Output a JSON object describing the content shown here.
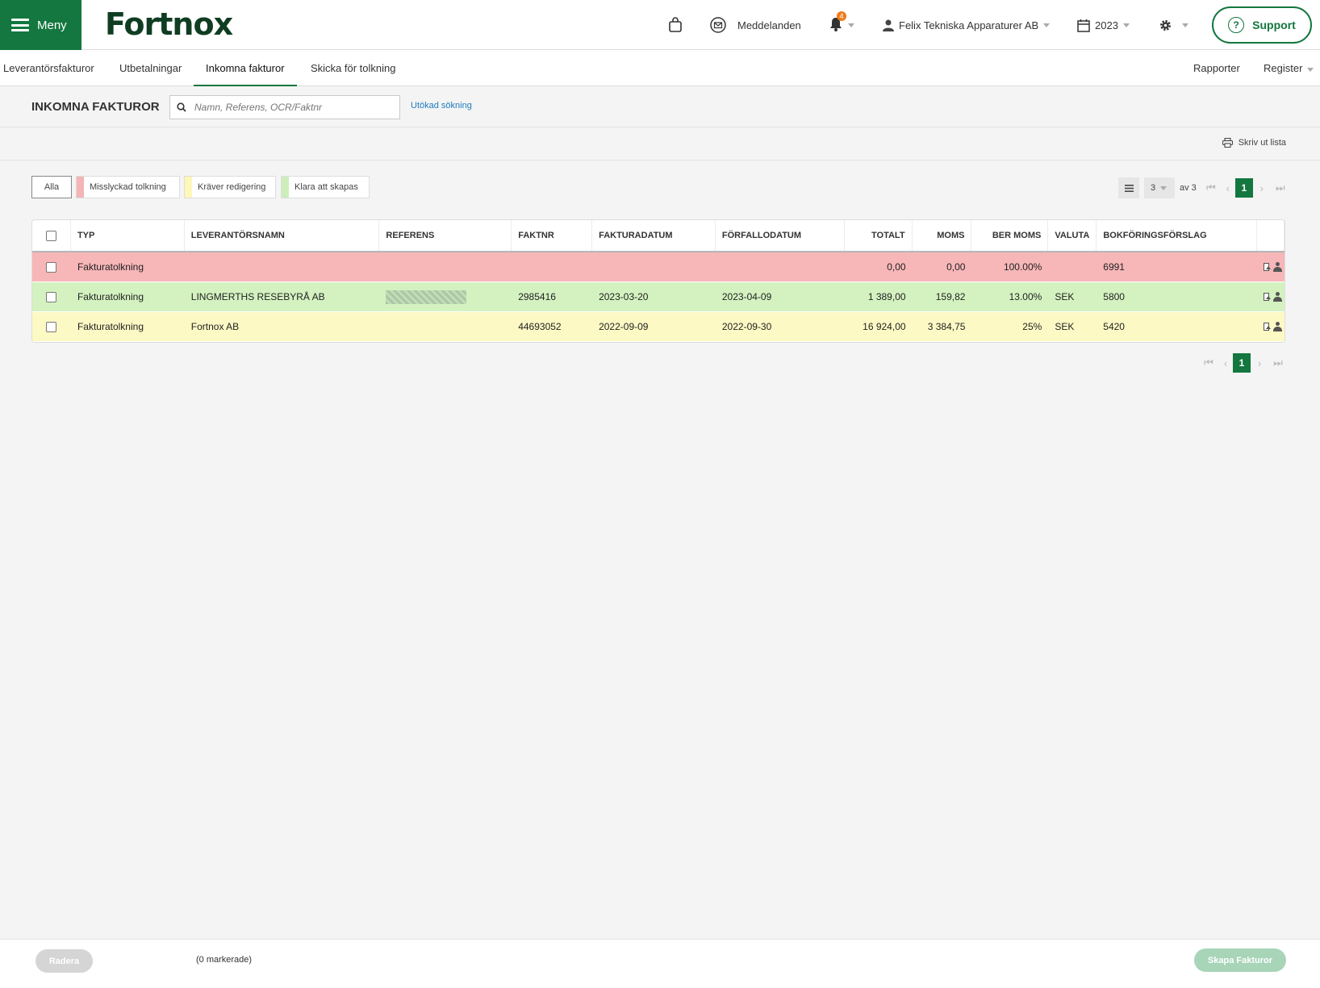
{
  "topbar": {
    "menu_label": "Meny",
    "logo_text": "Fortnox",
    "messages_label": "Meddelanden",
    "notifications_count": "4",
    "company_label": "Felix Tekniska Apparaturer AB",
    "year_label": "2023",
    "support_label": "Support"
  },
  "subnav": {
    "tabs": [
      {
        "label": "Leverantörsfakturor"
      },
      {
        "label": "Utbetalningar"
      },
      {
        "label": "Inkomna fakturor",
        "active": true
      },
      {
        "label": "Skicka för tolkning"
      }
    ],
    "right": [
      {
        "label": "Rapporter"
      },
      {
        "label": "Register"
      }
    ]
  },
  "header": {
    "title": "INKOMNA FAKTUROR",
    "search_placeholder": "Namn, Referens, OCR/Faktnr",
    "advanced_search": "Utökad sökning",
    "print_label": "Skriv ut lista"
  },
  "filters": [
    {
      "label": "Alla",
      "color": ""
    },
    {
      "label": "Misslyckad tolkning",
      "color": "#f5b4b6"
    },
    {
      "label": "Kräver redigering",
      "color": "#fdf7b8"
    },
    {
      "label": "Klara att skapas",
      "color": "#cdeebb"
    }
  ],
  "pager": {
    "per_page": "3",
    "of_label": "av 3",
    "current_page": "1"
  },
  "table": {
    "headers": [
      "TYP",
      "LEVERANTÖRSNAMN",
      "REFERENS",
      "FAKTNR",
      "FAKTURADATUM",
      "FÖRFALLODATUM",
      "TOTALT",
      "MOMS",
      "BER MOMS",
      "VALUTA",
      "BOKFÖRINGSFÖRSLAG"
    ],
    "rows": [
      {
        "status_color": "#f7b6b8",
        "type": "Fakturatolkning",
        "supplier": "",
        "reference_redacted": false,
        "invoice_no": "",
        "invoice_date": "",
        "due_date": "",
        "total": "0,00",
        "vat": "0,00",
        "calc_vat": "100.00%",
        "currency": "",
        "account_suggestion": "6991"
      },
      {
        "status_color": "#d3f2c0",
        "type": "Fakturatolkning",
        "supplier": "LINGMERTHS RESEBYRÅ AB",
        "reference_redacted": true,
        "invoice_no": "2985416",
        "invoice_date": "2023-03-20",
        "due_date": "2023-04-09",
        "total": "1 389,00",
        "vat": "159,82",
        "calc_vat": "13.00%",
        "currency": "SEK",
        "account_suggestion": "5800"
      },
      {
        "status_color": "#fdf9c4",
        "type": "Fakturatolkning",
        "supplier": "Fortnox AB",
        "reference_redacted": false,
        "invoice_no": "44693052",
        "invoice_date": "2022-09-09",
        "due_date": "2022-09-30",
        "total": "16 924,00",
        "vat": "3 384,75",
        "calc_vat": "25%",
        "currency": "SEK",
        "account_suggestion": "5420"
      }
    ]
  },
  "footer": {
    "delete_label": "Radera",
    "marked_label": "(0 markerade)",
    "create_label": "Skapa Fakturor"
  },
  "colors": {
    "brand": "#13773f",
    "link": "#1d7cbf"
  }
}
